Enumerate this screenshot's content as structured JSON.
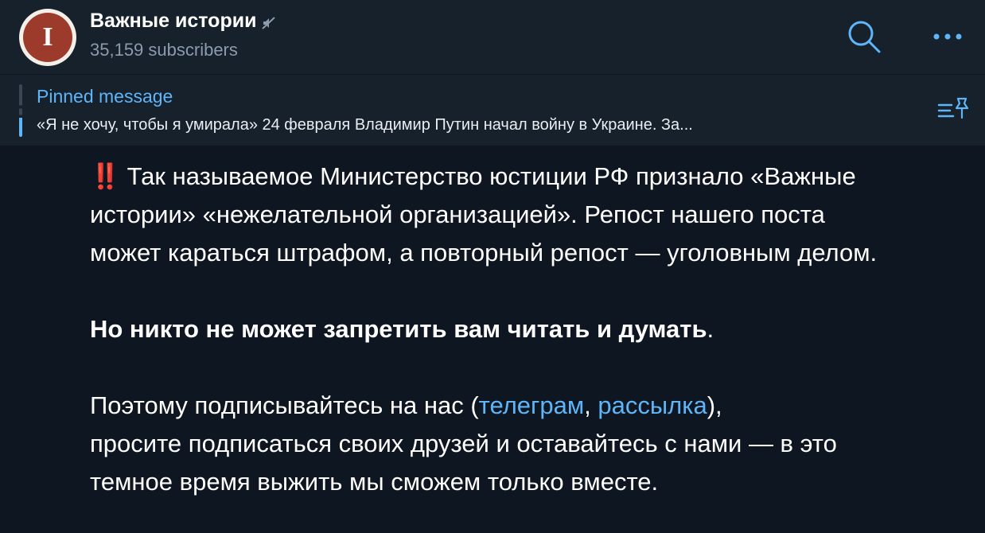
{
  "header": {
    "channel_title": "Важные истории",
    "avatar_letter": "I",
    "subscribers": "35,159 subscribers",
    "icons": {
      "search": "search-icon",
      "more": "more-icon",
      "muted": "muted-icon"
    }
  },
  "pinned": {
    "label": "Pinned message",
    "text": "«Я не хочу, чтобы я умирала»  24 февраля Владимир Путин начал войну в Украине. За..."
  },
  "message": {
    "emoji": "‼️",
    "para1": "Так называемое Министерство юстиции РФ признало «Важные истории» «нежелательной организацией». Репост нашего поста может караться штрафом, а повторный репост — уголовным делом.",
    "para2_bold": "Но никто не может запретить вам читать и думать",
    "para2_end": ".",
    "para3_start": "Поэтому подписывайтесь на нас (",
    "link_telegram": "телеграм",
    "comma": ", ",
    "link_mailing": "рассылка",
    "para3_mid": "),",
    "para3_rest": "просите подписаться своих друзей и оставайтесь с нами — в это темное время выжить мы сможем только вместе."
  },
  "colors": {
    "header_bg": "#17212b",
    "content_bg": "#0e1621",
    "accent": "#5eb5f7",
    "secondary_text": "#8c9bab",
    "avatar_red": "#9c3b2c"
  }
}
